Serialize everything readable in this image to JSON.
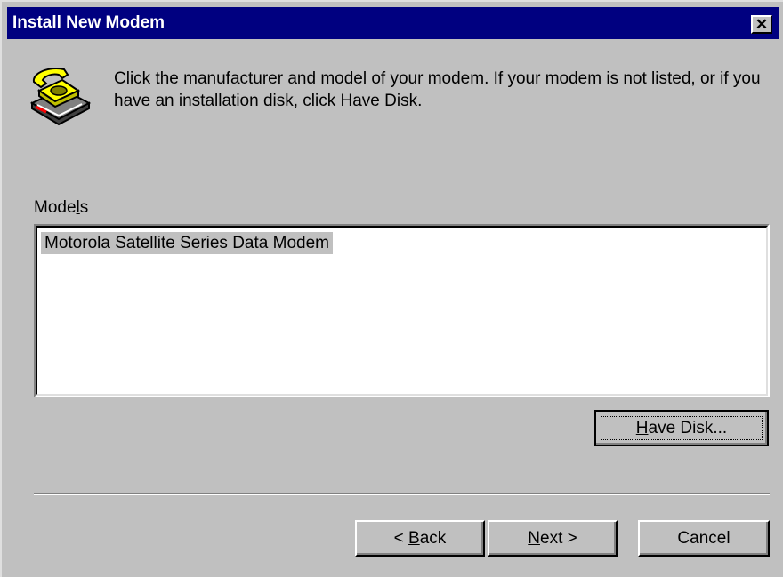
{
  "window": {
    "title": "Install New Modem",
    "close_glyph": "✕"
  },
  "header": {
    "icon": "modem-telephone-icon",
    "instruction": "Click the manufacturer and model of your modem. If your modem is not listed, or if you have an installation disk, click Have Disk."
  },
  "models": {
    "label_pre": "Mode",
    "label_accel": "l",
    "label_post": "s",
    "items": [
      {
        "label": "Motorola Satellite Series Data Modem",
        "selected": true
      }
    ]
  },
  "buttons": {
    "have_disk_accel": "H",
    "have_disk_rest": "ave Disk...",
    "back_prefix": "< ",
    "back_accel": "B",
    "back_rest": "ack",
    "next_accel": "N",
    "next_rest": "ext >",
    "cancel": "Cancel"
  },
  "colors": {
    "face": "#c0c0c0",
    "titlebar": "#000080",
    "selection": "#c0c0c0"
  }
}
